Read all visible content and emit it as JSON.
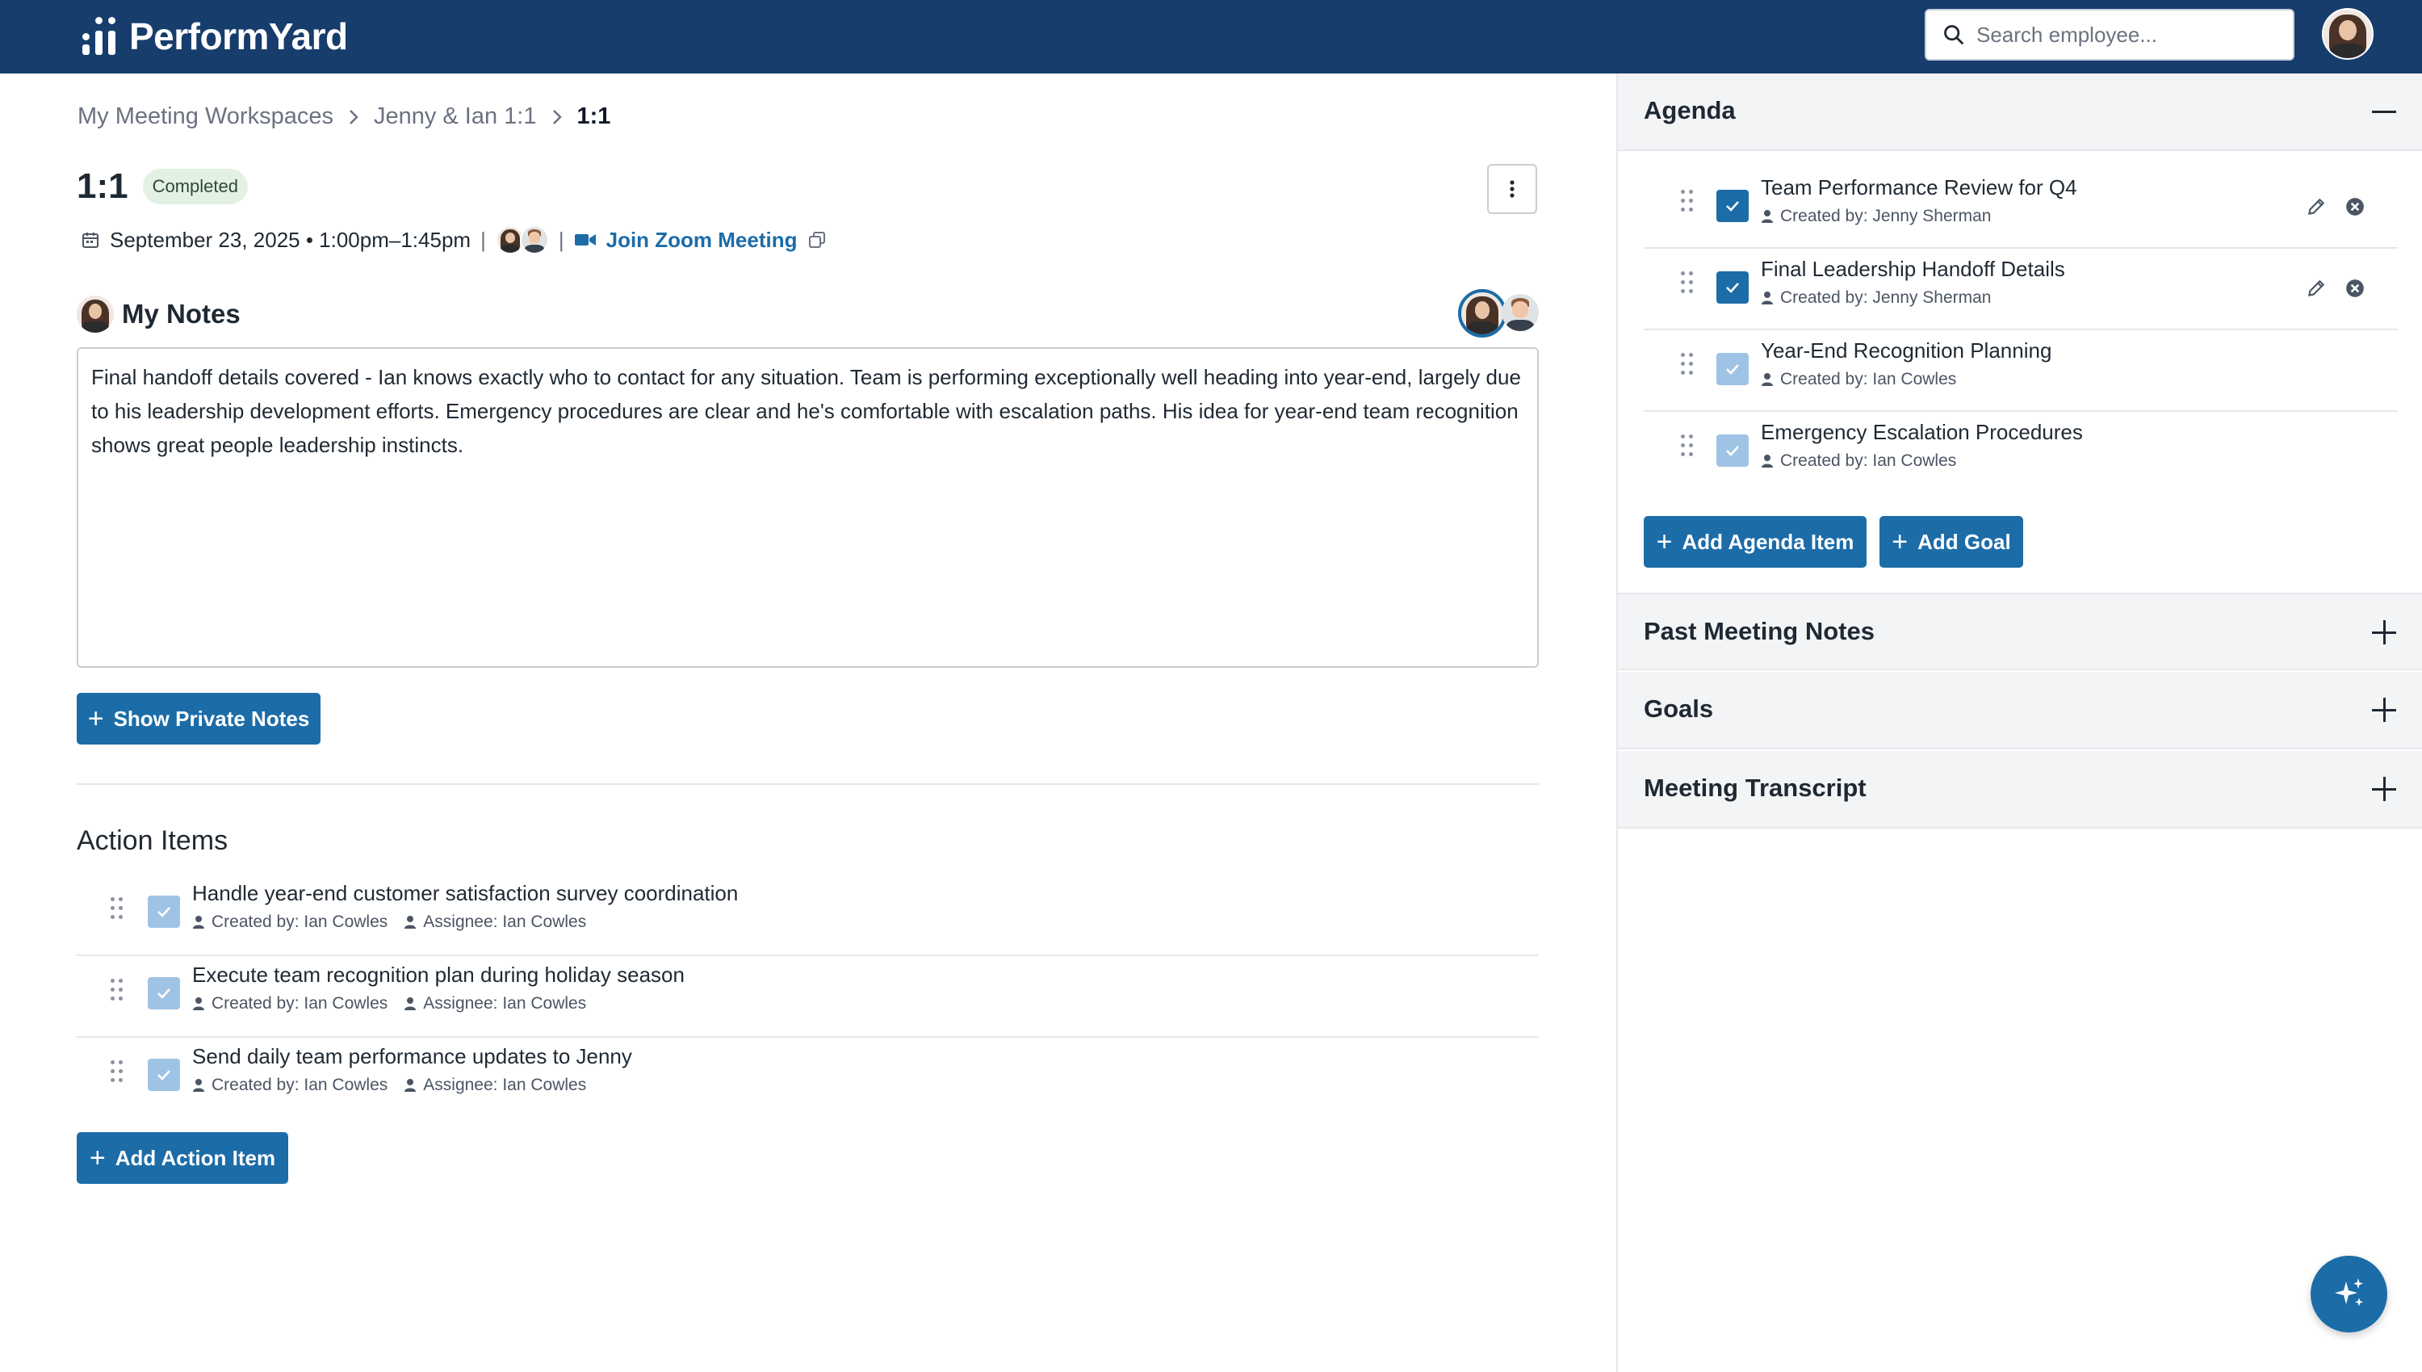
{
  "app": {
    "logo_text": "PerformYard",
    "search_placeholder": "Search employee..."
  },
  "breadcrumb": [
    {
      "label": "My Meeting Workspaces"
    },
    {
      "label": "Jenny & Ian 1:1"
    },
    {
      "label": "1:1"
    }
  ],
  "meeting": {
    "title": "1:1",
    "status_badge": "Completed",
    "date_time": "September 23, 2025 • 1:00pm–1:45pm",
    "join_label": "Join Zoom Meeting"
  },
  "notes": {
    "title": "My Notes",
    "text": "Final handoff details covered - Ian knows exactly who to contact for any situation. Team is performing exceptionally well heading into year-end, largely due to his leadership development efforts. Emergency procedures are clear and he's comfortable with escalation paths. His idea for year-end team recognition shows great people leadership instincts.",
    "private_button": "Show Private Notes"
  },
  "action_items": {
    "title": "Action Items",
    "items": [
      {
        "text": "Handle year-end customer satisfaction survey coordination",
        "created": "Created by: Ian Cowles",
        "assignee": "Assignee: Ian Cowles"
      },
      {
        "text": "Execute team recognition plan during holiday season",
        "created": "Created by: Ian Cowles",
        "assignee": "Assignee: Ian Cowles"
      },
      {
        "text": "Send daily team performance updates to Jenny",
        "created": "Created by: Ian Cowles",
        "assignee": "Assignee: Ian Cowles"
      }
    ],
    "add_button": "Add Action Item"
  },
  "agenda": {
    "title": "Agenda",
    "items": [
      {
        "text": "Team Performance Review for Q4",
        "created": "Created by: Jenny Sherman"
      },
      {
        "text": "Final Leadership Handoff Details",
        "created": "Created by: Jenny Sherman"
      },
      {
        "text": "Year-End Recognition Planning",
        "created": "Created by: Ian Cowles"
      },
      {
        "text": "Emergency Escalation Procedures",
        "created": "Created by: Ian Cowles"
      }
    ],
    "add_item_button": "Add Agenda Item",
    "add_goal_button": "Add Goal"
  },
  "panels": {
    "past_notes": "Past Meeting Notes",
    "goals": "Goals",
    "transcript": "Meeting Transcript"
  },
  "colors": {
    "header_bg": "#173d6d",
    "accent": "#1c6ca8",
    "badge_bg": "#e3f1e5"
  }
}
